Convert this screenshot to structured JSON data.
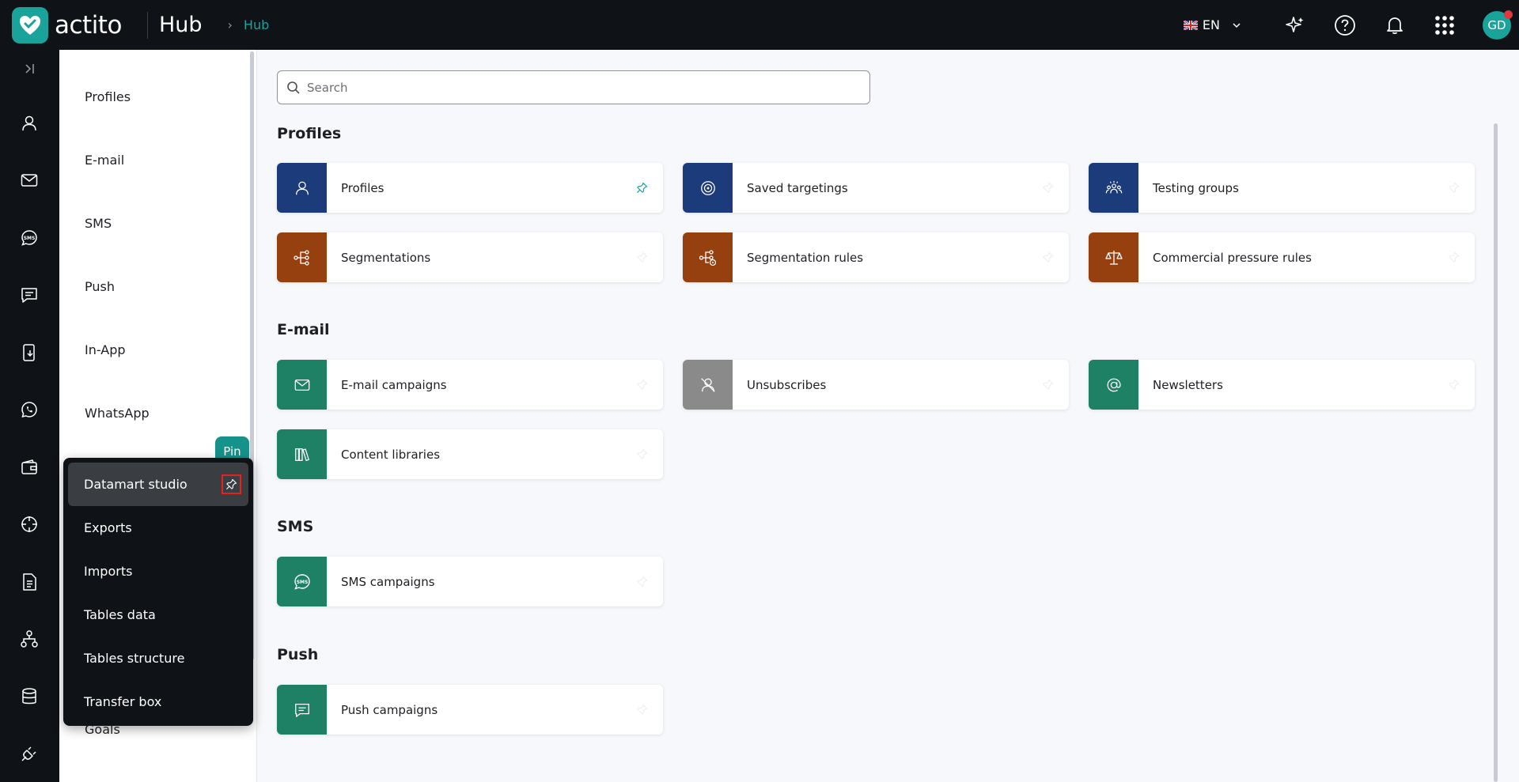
{
  "header": {
    "logo_text": "actito",
    "app_title": "Hub",
    "breadcrumb": "Hub",
    "language": "EN"
  },
  "sidebar": {
    "items": [
      "Profiles",
      "E-mail",
      "SMS",
      "Push",
      "In-App",
      "WhatsApp",
      "Goals"
    ]
  },
  "flyout": {
    "tooltip": "Pin",
    "items": [
      "Datamart studio",
      "Exports",
      "Imports",
      "Tables data",
      "Tables structure",
      "Transfer box"
    ]
  },
  "user": {
    "initials": "GD"
  },
  "search": {
    "placeholder": "Search"
  },
  "colors": {
    "teal": "#1aa39a",
    "profiles_blue": "#1c3b7a",
    "segment_brown": "#97400f",
    "email_green": "#1e8064",
    "gray": "#8a8a8a"
  },
  "sections": [
    {
      "title": "Profiles",
      "cards": [
        {
          "label": "Profiles",
          "icon": "person-icon",
          "pinned": true
        },
        {
          "label": "Saved targetings",
          "icon": "target-icon",
          "pinned": false
        },
        {
          "label": "Testing groups",
          "icon": "group-icon",
          "pinned": false
        },
        {
          "label": "Segmentations",
          "icon": "segmentation-icon",
          "pinned": false
        },
        {
          "label": "Segmentation rules",
          "icon": "segmentation-rules-icon",
          "pinned": false
        },
        {
          "label": "Commercial pressure rules",
          "icon": "scale-icon",
          "pinned": false
        }
      ]
    },
    {
      "title": "E-mail",
      "cards": [
        {
          "label": "E-mail campaigns",
          "icon": "envelope-icon",
          "pinned": false
        },
        {
          "label": "Unsubscribes",
          "icon": "unsubscribe-icon",
          "pinned": false
        },
        {
          "label": "Newsletters",
          "icon": "at-icon",
          "pinned": false
        },
        {
          "label": "Content libraries",
          "icon": "library-icon",
          "pinned": false
        }
      ]
    },
    {
      "title": "SMS",
      "cards": [
        {
          "label": "SMS campaigns",
          "icon": "sms-icon",
          "pinned": false
        }
      ]
    },
    {
      "title": "Push",
      "cards": [
        {
          "label": "Push campaigns",
          "icon": "chat-icon",
          "pinned": false
        }
      ]
    }
  ]
}
